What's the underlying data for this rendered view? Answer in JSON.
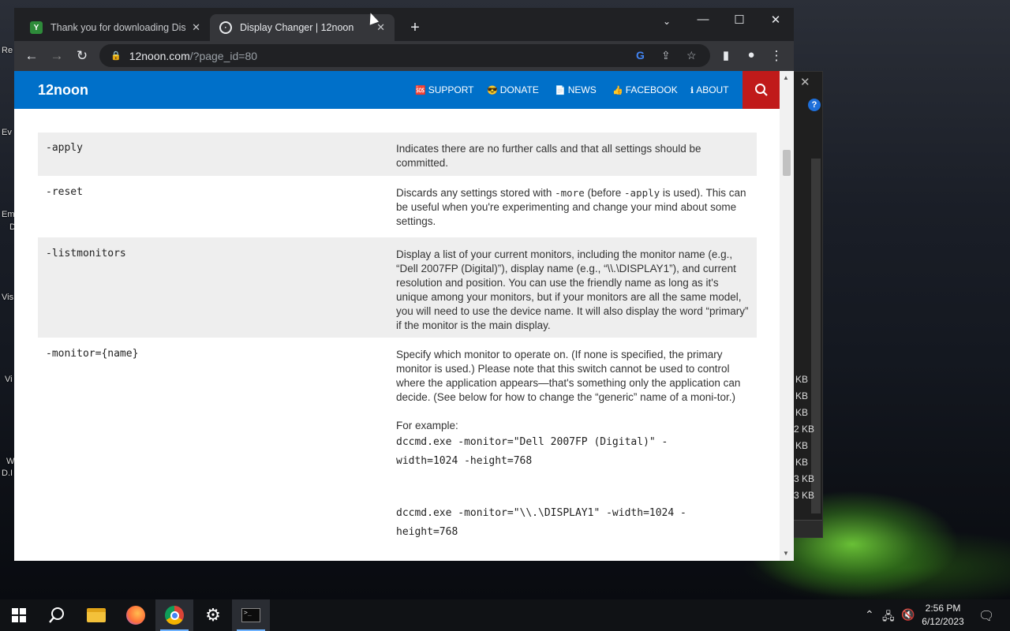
{
  "desktop": {
    "icon_labels": [
      "Re",
      "Ev",
      "Em",
      "D",
      "Vis",
      "Vi",
      "W",
      "D.I"
    ]
  },
  "background_window": {
    "sizes": [
      "KB",
      "KB",
      "KB",
      "2 KB",
      "KB",
      "KB",
      "3 KB",
      "3 KB"
    ]
  },
  "browser": {
    "tabs": [
      {
        "title": "Thank you for downloading Disp",
        "active": false
      },
      {
        "title": "Display Changer | 12noon",
        "active": true
      }
    ],
    "url_host": "12noon.com",
    "url_path": "/?page_id=80"
  },
  "site": {
    "brand": "12noon",
    "nav": [
      {
        "icon": "🆘",
        "label": "SUPPORT"
      },
      {
        "icon": "😎",
        "label": "DONATE"
      },
      {
        "icon": "📄",
        "label": "NEWS"
      },
      {
        "icon": "👍",
        "label": "FACEBOOK"
      },
      {
        "icon": "ℹ",
        "label": "ABOUT"
      }
    ]
  },
  "options": [
    {
      "switch": "-apply",
      "desc": "Indicates there are no further calls and that all settings should be committed."
    },
    {
      "switch": "-reset",
      "desc_parts": [
        "Discards any settings stored with ",
        "-more",
        " (before ",
        "-apply",
        " is used). This can be useful when you're experimenting and change your mind about some settings."
      ]
    },
    {
      "switch": "-listmonitors",
      "desc": "Display a list of your current monitors, including the monitor name (e.g., “Dell 2007FP (Digital)”), display name (e.g., “\\\\.\\DISPLAY1”), and current resolution and position. You can use the friendly name as long as it's unique among your monitors, but if your monitors are all the same model, you will need to use the device name. It will also display the word “primary” if the monitor is the main display."
    },
    {
      "switch": "-monitor={name}",
      "desc": "Specify which monitor to operate on. (If none is specified, the primary monitor is used.) Please note that this switch cannot be used to control where the application appears—that's something only the application can decide. (See below for how to change the “generic” name of a moni-tor.)",
      "example_label": "For example:",
      "example1_line1": "dccmd.exe -monitor=\"Dell 2007FP (Digital)\" -",
      "example1_line2": "width=1024 -height=768",
      "example2_line1": "dccmd.exe -monitor=\"\\\\.\\DISPLAY1\" -width=1024 -",
      "example2_line2": "height=768"
    }
  ],
  "taskbar": {
    "time": "2:56 PM",
    "date": "6/12/2023"
  }
}
